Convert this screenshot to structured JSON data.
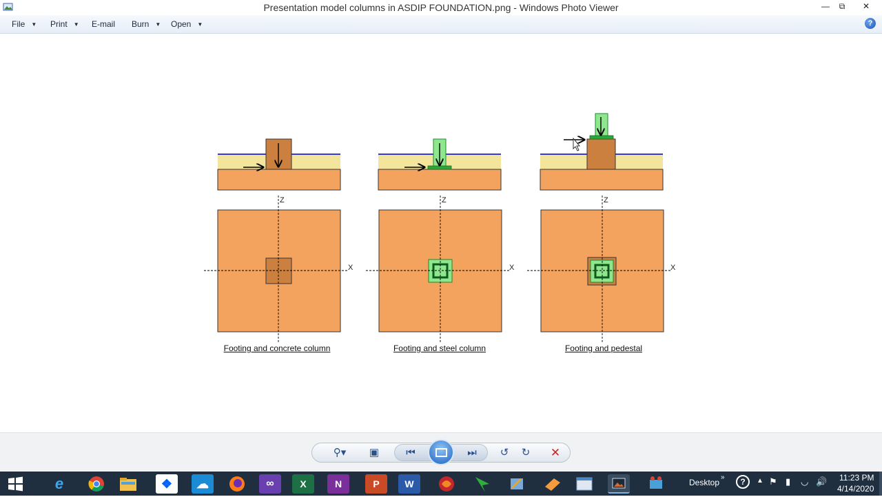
{
  "window": {
    "title": "Presentation model columns in ASDIP FOUNDATION.png - Windows Photo Viewer"
  },
  "menu": {
    "items": [
      {
        "label": "File",
        "has_arrow": true
      },
      {
        "label": "Print",
        "has_arrow": true
      },
      {
        "label": "E-mail",
        "has_arrow": false
      },
      {
        "label": "Burn",
        "has_arrow": true
      },
      {
        "label": "Open",
        "has_arrow": true
      }
    ],
    "help_label": "?"
  },
  "image": {
    "axis_z": "Z",
    "axis_x": "X",
    "captions": [
      "Footing and concrete column",
      "Footing and steel column",
      "Footing and pedestal"
    ],
    "colors": {
      "footing": "#f4a35e",
      "concrete": "#cc8040",
      "soil": "#f3e59c",
      "steel": "#8ee68e",
      "steel_dark": "#1f8a2a",
      "grade_line": "#3a3ac8"
    }
  },
  "taskbar": {
    "desktop_label": "Desktop",
    "time": "11:23 PM",
    "date": "4/14/2020",
    "apps": [
      "windows-start",
      "internet-explorer",
      "chrome",
      "file-explorer",
      "dropbox",
      "onedrive",
      "firefox",
      "visual-studio",
      "excel",
      "onenote",
      "powerpoint",
      "word",
      "app-red",
      "app-green",
      "app-tools",
      "app-orange",
      "app-window",
      "app-photo-viewer",
      "app-presentation"
    ]
  }
}
